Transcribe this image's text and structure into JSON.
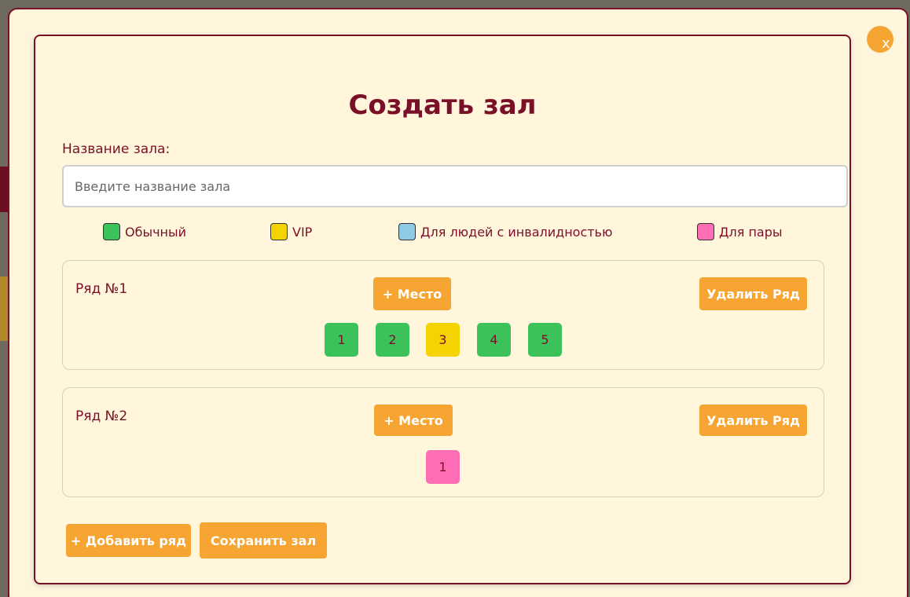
{
  "modal": {
    "title": "Создать зал",
    "close_label": "x"
  },
  "form": {
    "name_label": "Название зала:",
    "name_value": "",
    "name_placeholder": "Введите название зала"
  },
  "legend": [
    {
      "label": "Обычный",
      "color": "#3cc25a"
    },
    {
      "label": "VIP",
      "color": "#f5d300"
    },
    {
      "label": "Для людей с инвалидностью",
      "color": "#8ecae6"
    },
    {
      "label": "Для пары",
      "color": "#ff6eb4"
    }
  ],
  "rows": [
    {
      "label": "Ряд №1",
      "add_seat_label": "+ Место",
      "delete_row_label": "Удалить Ряд",
      "seats": [
        {
          "number": "1",
          "type": "regular",
          "color": "#3cc25a"
        },
        {
          "number": "2",
          "type": "regular",
          "color": "#3cc25a"
        },
        {
          "number": "3",
          "type": "vip",
          "color": "#f5d300"
        },
        {
          "number": "4",
          "type": "regular",
          "color": "#3cc25a"
        },
        {
          "number": "5",
          "type": "regular",
          "color": "#3cc25a"
        }
      ]
    },
    {
      "label": "Ряд №2",
      "add_seat_label": "+ Место",
      "delete_row_label": "Удалить Ряд",
      "seats": [
        {
          "number": "1",
          "type": "couple",
          "color": "#ff6eb4"
        }
      ]
    }
  ],
  "footer": {
    "add_row_label": "+ Добавить ряд",
    "save_label": "Сохранить зал"
  },
  "colors": {
    "accent": "#f6a532",
    "brand": "#7a1028",
    "panel_bg": "#fff6dc"
  }
}
